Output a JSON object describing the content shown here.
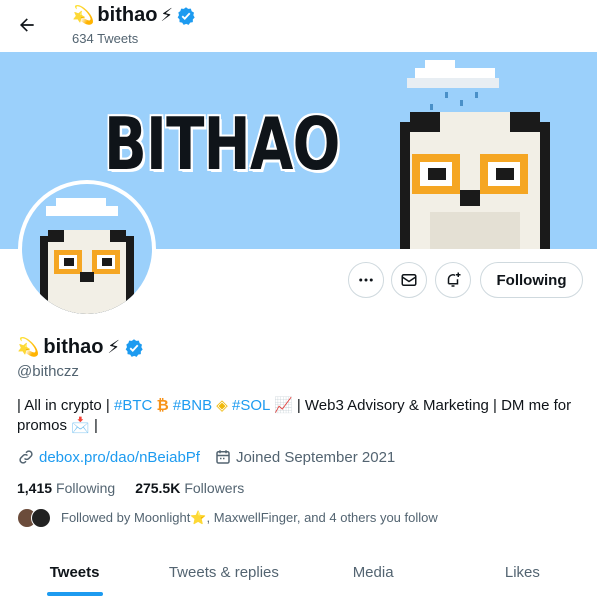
{
  "header": {
    "name": "bithao",
    "tweet_count": "634 Tweets"
  },
  "banner": {
    "text": "BITHAO"
  },
  "actions": {
    "more_icon": "more-icon",
    "message_icon": "envelope-icon",
    "notify_icon": "bell-plus-icon",
    "following_label": "Following"
  },
  "profile": {
    "name": "bithao",
    "handle": "@bithczz",
    "bio_parts": {
      "p1": "| All in crypto | ",
      "btc": "#BTC",
      "bnb": "#BNB",
      "sol": "#SOL",
      "p2": " | Web3 Advisory & Marketing | DM me for promos ",
      "p3": " |"
    },
    "link": "debox.pro/dao/nBeiabPf",
    "joined": "Joined September 2021",
    "following_count": "1,415",
    "following_label": "Following",
    "followers_count": "275.5K",
    "followers_label": "Followers",
    "followed_by": "Followed by Moonlight⭐, MaxwellFinger, and 4 others you follow"
  },
  "tabs": [
    {
      "label": "Tweets",
      "active": true
    },
    {
      "label": "Tweets & replies",
      "active": false
    },
    {
      "label": "Media",
      "active": false
    },
    {
      "label": "Likes",
      "active": false
    }
  ],
  "colors": {
    "accent": "#1d9bf0",
    "banner": "#9bd0fb",
    "text": "#0f1419",
    "muted": "#536471"
  }
}
